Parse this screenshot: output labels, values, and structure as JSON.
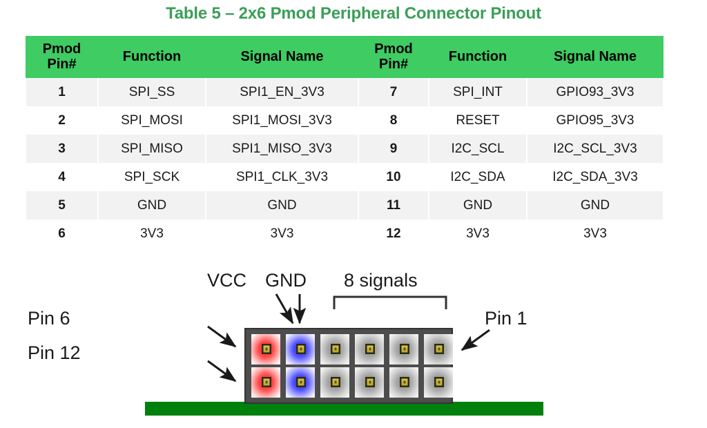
{
  "title": "Table 5 – 2x6 Pmod Peripheral Connector Pinout",
  "colors": {
    "title_green": "#3a9e58",
    "header_green": "#3ecc63",
    "row_stripe": "#f2f2f2",
    "pcb_green": "#00800d",
    "housing_gray": "#4d4d4d",
    "vcc_red": "#ff2a2a",
    "gnd_blue": "#2a2aff",
    "signal_gray": "#9a9a9a",
    "pin_gold": "#c8b432"
  },
  "table": {
    "headers": [
      {
        "line1": "Pmod",
        "line2": "Pin#"
      },
      {
        "line1": "Function",
        "line2": ""
      },
      {
        "line1": "Signal Name",
        "line2": ""
      },
      {
        "line1": "Pmod",
        "line2": "Pin#"
      },
      {
        "line1": "Function",
        "line2": ""
      },
      {
        "line1": "Signal Name",
        "line2": ""
      }
    ],
    "rows": [
      [
        "1",
        "SPI_SS",
        "SPI1_EN_3V3",
        "7",
        "SPI_INT",
        "GPIO93_3V3"
      ],
      [
        "2",
        "SPI_MOSI",
        "SPI1_MOSI_3V3",
        "8",
        "RESET",
        "GPIO95_3V3"
      ],
      [
        "3",
        "SPI_MISO",
        "SPI1_MISO_3V3",
        "9",
        "I2C_SCL",
        "I2C_SCL_3V3"
      ],
      [
        "4",
        "SPI_SCK",
        "SPI1_CLK_3V3",
        "10",
        "I2C_SDA",
        "I2C_SDA_3V3"
      ],
      [
        "5",
        "GND",
        "GND",
        "11",
        "GND",
        "GND"
      ],
      [
        "6",
        "3V3",
        "3V3",
        "12",
        "3V3",
        "3V3"
      ]
    ]
  },
  "diagram": {
    "labels": {
      "vcc": "VCC",
      "gnd": "GND",
      "signals": "8 signals",
      "pin6": "Pin 6",
      "pin12": "Pin 12",
      "pin1": "Pin 1"
    },
    "pin_types_top": [
      "vcc",
      "gnd",
      "signal",
      "signal",
      "signal",
      "signal"
    ],
    "pin_types_bottom": [
      "vcc",
      "gnd",
      "signal",
      "signal",
      "signal",
      "signal"
    ]
  }
}
